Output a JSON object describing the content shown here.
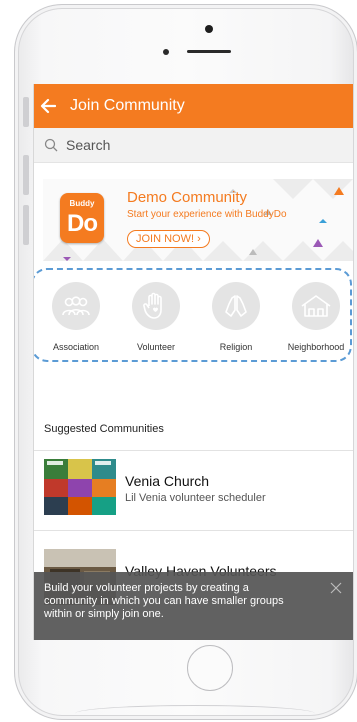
{
  "appbar": {
    "title": "Join Community"
  },
  "search": {
    "placeholder": "Search"
  },
  "banner": {
    "logo_top": "Buddy",
    "logo_main": "Do",
    "title": "Demo Community",
    "subtitle": "Start your experience with BuddyDo",
    "button_label": "JOIN NOW! ›"
  },
  "categories": [
    {
      "label": "Association",
      "icon": "people-icon"
    },
    {
      "label": "Volunteer",
      "icon": "hand-heart-icon"
    },
    {
      "label": "Religion",
      "icon": "praying-hands-icon"
    },
    {
      "label": "Neighborhood",
      "icon": "houses-icon"
    }
  ],
  "suggested": {
    "title": "Suggested Communities",
    "items": [
      {
        "name": "Venia Church",
        "description": "Lil Venia volunteer scheduler"
      },
      {
        "name": "Valley Haven Volunteers",
        "description": ""
      }
    ]
  },
  "toast": {
    "text": "Build your volunteer projects by creating a community in which you can have smaller groups within or simply join one."
  },
  "colors": {
    "accent": "#f47b20",
    "highlight_border": "#5b9bd5"
  }
}
